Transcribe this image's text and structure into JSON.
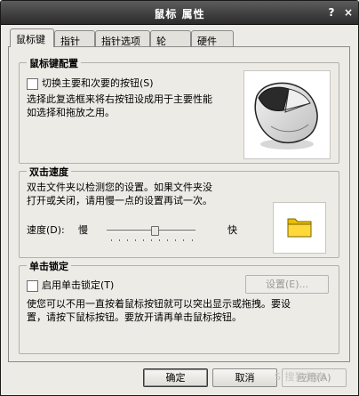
{
  "window": {
    "title": "鼠标 属性",
    "help_symbol": "?",
    "close_symbol": "×"
  },
  "tabs": [
    {
      "label": "鼠标键",
      "active": true
    },
    {
      "label": "指针",
      "active": false
    },
    {
      "label": "指针选项",
      "active": false
    },
    {
      "label": "轮",
      "active": false
    },
    {
      "label": "硬件",
      "active": false
    }
  ],
  "button_config": {
    "title": "鼠标键配置",
    "swap_label": "切换主要和次要的按钮(S)",
    "swap_checked": false,
    "description_line1": "选择此复选框来将右按钮设成用于主要性能",
    "description_line2": "如选择和拖放之用。",
    "image_icon": "mouse-icon"
  },
  "double_click": {
    "title": "双击速度",
    "description_line1": "双击文件夹以检测您的设置。如果文件夹没",
    "description_line2": "打开或关闭，请用慢一点的设置再试一次。",
    "speed_label": "速度(D):",
    "slow_label": "慢",
    "fast_label": "快",
    "slider_value_fraction": 0.55,
    "test_icon": "folder-icon"
  },
  "click_lock": {
    "title": "单击锁定",
    "enable_label": "启用单击锁定(T)",
    "enable_checked": false,
    "settings_label": "设置(E)...",
    "description_line1": "使您可以不用一直按着鼠标按钮就可以突出显示或拖拽。要设",
    "description_line2": "置，请按下鼠标按钮。要放开请再单击鼠标按钮。"
  },
  "footer": {
    "ok_label": "确定",
    "cancel_label": "取消",
    "apply_label": "应用(A)"
  },
  "watermark": "S 搜狗指南"
}
